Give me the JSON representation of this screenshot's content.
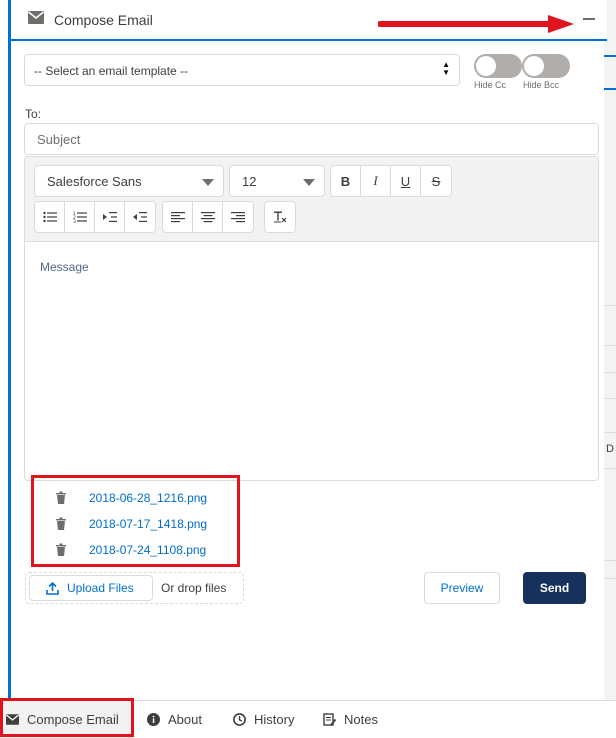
{
  "panel": {
    "title": "Compose Email"
  },
  "composer": {
    "template_select": "-- Select an email template --",
    "hide_cc_label": "Hide Cc",
    "hide_bcc_label": "Hide Bcc",
    "to_label": "To:",
    "subject_placeholder": "Subject",
    "font_family": "Salesforce Sans",
    "font_size": "12",
    "message_placeholder": "Message"
  },
  "attachments": [
    {
      "name": "2018-06-28_1216.png"
    },
    {
      "name": "2018-07-17_1418.png"
    },
    {
      "name": "2018-07-24_1108.png"
    }
  ],
  "upload": {
    "button_label": "Upload Files",
    "drop_text": "Or drop files"
  },
  "actions": {
    "preview_label": "Preview",
    "send_label": "Send"
  },
  "utility_bar": {
    "items": [
      {
        "label": "Compose Email",
        "icon": "email-icon"
      },
      {
        "label": "About",
        "icon": "info-icon"
      },
      {
        "label": "History",
        "icon": "clock-icon"
      },
      {
        "label": "Notes",
        "icon": "note-icon"
      }
    ]
  },
  "background": {
    "edge_text": "D"
  },
  "colors": {
    "brand": "#0070d2",
    "send_button": "#16325c",
    "annotation": "#e0141e"
  }
}
